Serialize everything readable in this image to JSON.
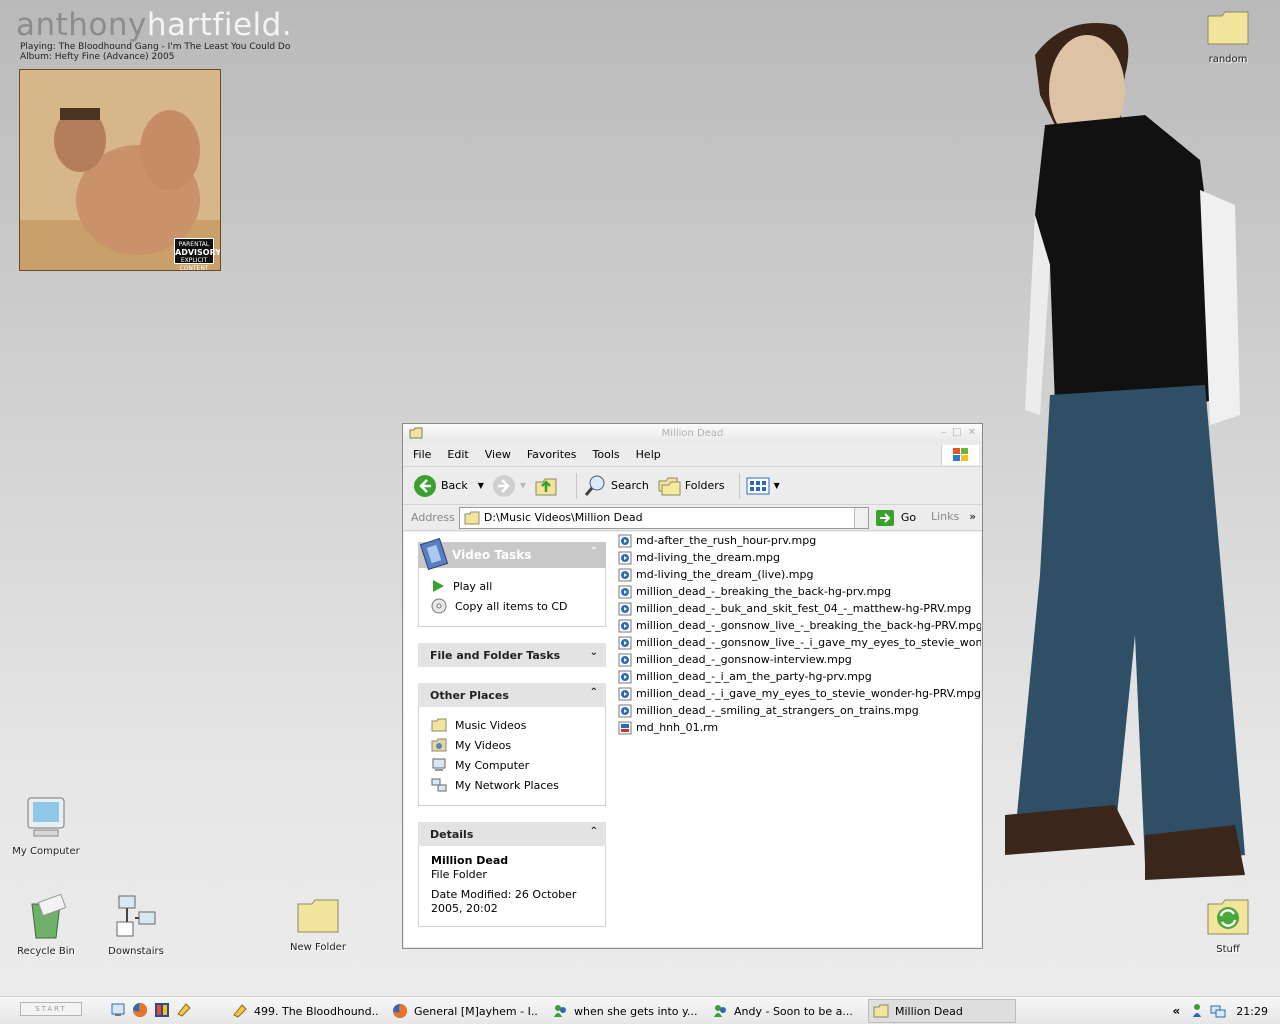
{
  "desktop": {
    "brand_first": "anthony",
    "brand_last": "hartfield.",
    "now_playing": "Playing: The Bloodhound Gang - I'm The Least You Could Do",
    "album_line": "Album: Hefty Fine (Advance)   2005",
    "advisory_top": "PARENTAL",
    "advisory_main": "ADVISORY",
    "advisory_bottom": "EXPLICIT CONTENT",
    "icons": {
      "random": "random",
      "my_computer": "My Computer",
      "recycle_bin": "Recycle Bin",
      "downstairs": "Downstairs",
      "new_folder": "New Folder",
      "stuff": "Stuff"
    }
  },
  "window": {
    "title": "Million Dead",
    "menus": [
      "File",
      "Edit",
      "View",
      "Favorites",
      "Tools",
      "Help"
    ],
    "toolbar": {
      "back": "Back",
      "search": "Search",
      "folders": "Folders"
    },
    "address": {
      "label": "Address",
      "value": "D:\\Music Videos\\Million Dead",
      "go": "Go",
      "links": "Links",
      "links_chevron": "»"
    },
    "task_pane": {
      "video_tasks": {
        "title": "Video Tasks",
        "items": [
          "Play all",
          "Copy all items to CD"
        ]
      },
      "file_folder_tasks": {
        "title": "File and Folder Tasks"
      },
      "other_places": {
        "title": "Other Places",
        "items": [
          "Music Videos",
          "My Videos",
          "My Computer",
          "My Network Places"
        ]
      },
      "details": {
        "title": "Details",
        "name": "Million Dead",
        "type": "File Folder",
        "modified": "Date Modified: 26 October 2005, 20:02"
      }
    },
    "files": [
      "md-after_the_rush_hour-prv.mpg",
      "md-living_the_dream.mpg",
      "md-living_the_dream_(live).mpg",
      "million_dead_-_breaking_the_back-hg-prv.mpg",
      "million_dead_-_buk_and_skit_fest_04_-_matthew-hg-PRV.mpg",
      "million_dead_-_gonsnow_live_-_breaking_the_back-hg-PRV.mpg",
      "million_dead_-_gonsnow_live_-_i_gave_my_eyes_to_stevie_wonder-hg",
      "million_dead_-_gonsnow-interview.mpg",
      "million_dead_-_i_am_the_party-hg-prv.mpg",
      "million_dead_-_i_gave_my_eyes_to_stevie_wonder-hg-PRV.mpg",
      "million_dead_-_smiling_at_strangers_on_trains.mpg",
      "md_hnh_01.rm"
    ]
  },
  "taskbar": {
    "start": "START",
    "tasks": [
      "499. The Bloodhound...",
      "General [M]ayhem - I...",
      "when she gets into y...",
      "Andy -  Soon to be a...",
      "Million Dead"
    ],
    "tray_chevron": "«",
    "clock": "21:29"
  },
  "colors": {
    "accent_green": "#3aa030",
    "folder_yellow": "#f2e49a",
    "task_pane_header": "#e3e3e3"
  }
}
